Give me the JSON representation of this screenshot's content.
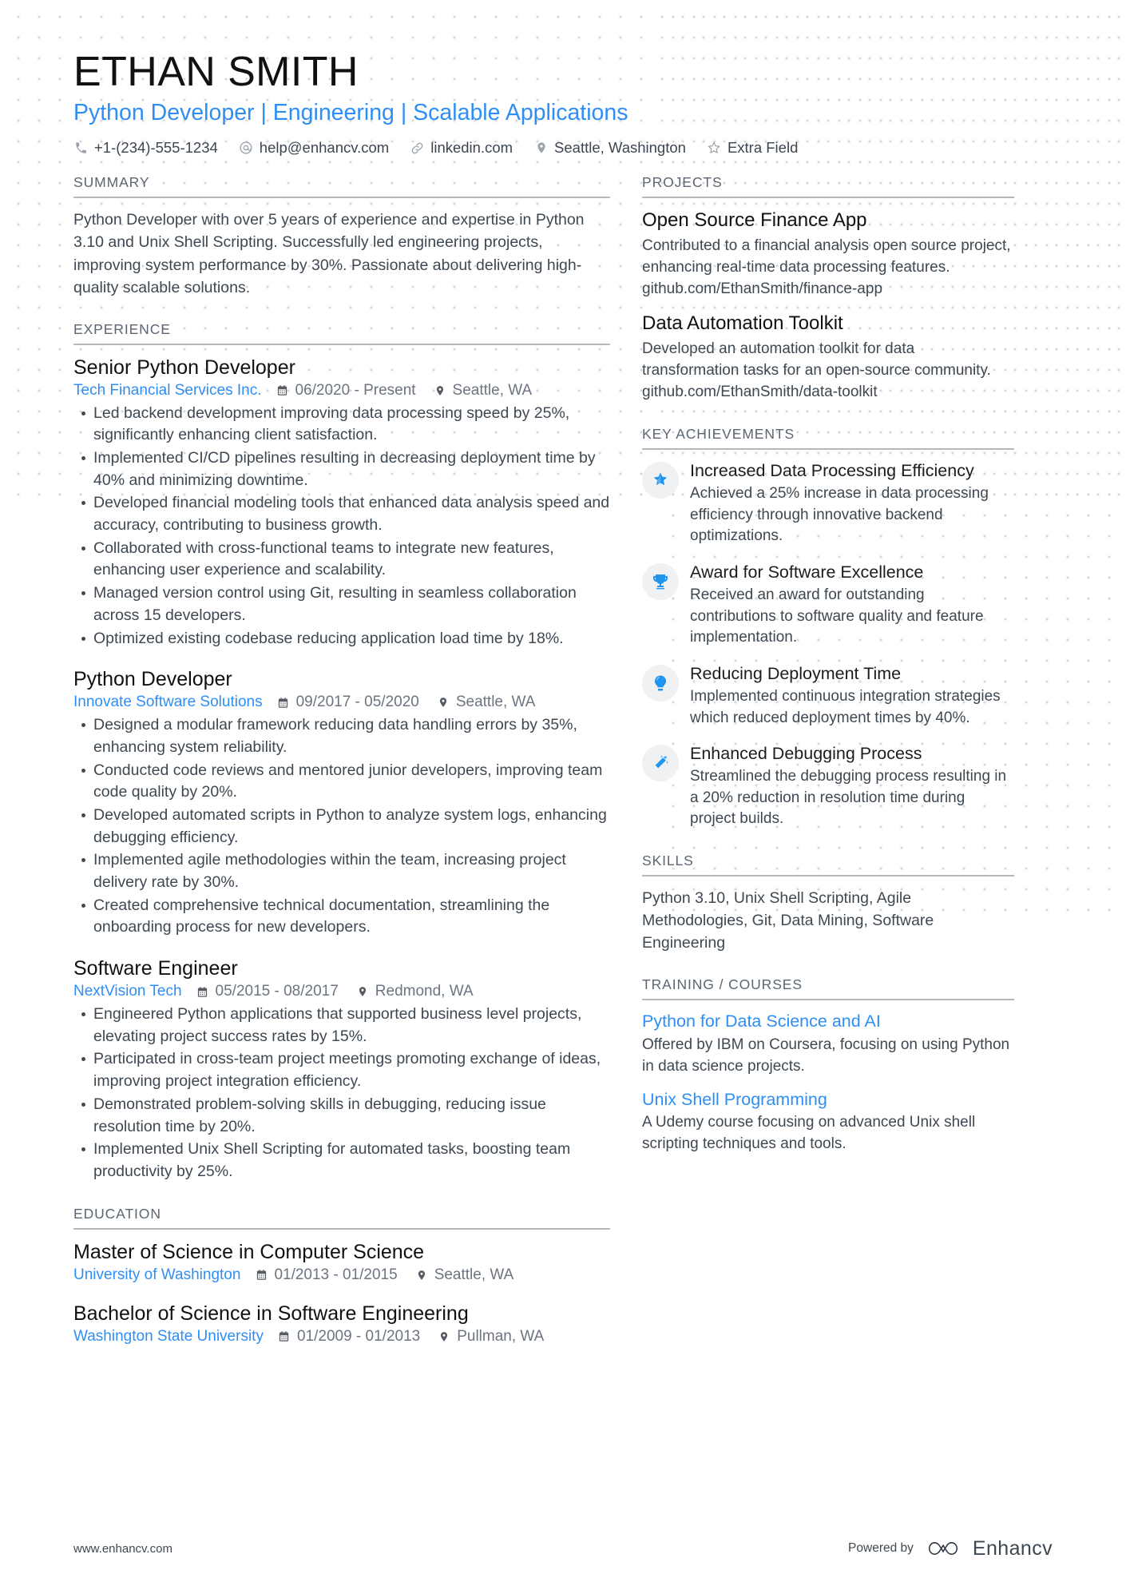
{
  "header": {
    "name": "ETHAN SMITH",
    "headline": "Python Developer | Engineering | Scalable Applications",
    "contacts": [
      {
        "icon": "phone-icon",
        "text": "+1-(234)-555-1234"
      },
      {
        "icon": "email-icon",
        "text": "help@enhancv.com"
      },
      {
        "icon": "link-icon",
        "text": "linkedin.com"
      },
      {
        "icon": "location-pin-icon",
        "text": "Seattle, Washington"
      },
      {
        "icon": "star-outline-icon",
        "text": "Extra Field"
      }
    ]
  },
  "summary": {
    "title": "SUMMARY",
    "text": "Python Developer with over 5 years of experience and expertise in Python 3.10 and Unix Shell Scripting. Successfully led engineering projects, improving system performance by 30%. Passionate about delivering high-quality scalable solutions."
  },
  "experience": {
    "title": "EXPERIENCE",
    "entries": [
      {
        "role": "Senior Python Developer",
        "company": "Tech Financial Services Inc.",
        "dates": "06/2020 - Present",
        "location": "Seattle, WA",
        "bullets": [
          "Led backend development improving data processing speed by 25%, significantly enhancing client satisfaction.",
          "Implemented CI/CD pipelines resulting in decreasing deployment time by 40% and minimizing downtime.",
          "Developed financial modeling tools that enhanced data analysis speed and accuracy, contributing to business growth.",
          "Collaborated with cross-functional teams to integrate new features, enhancing user experience and scalability.",
          "Managed version control using Git, resulting in seamless collaboration across 15 developers.",
          "Optimized existing codebase reducing application load time by 18%."
        ]
      },
      {
        "role": "Python Developer",
        "company": "Innovate Software Solutions",
        "dates": "09/2017 - 05/2020",
        "location": "Seattle, WA",
        "bullets": [
          "Designed a modular framework reducing data handling errors by 35%, enhancing system reliability.",
          "Conducted code reviews and mentored junior developers, improving team code quality by 20%.",
          "Developed automated scripts in Python to analyze system logs, enhancing debugging efficiency.",
          "Implemented agile methodologies within the team, increasing project delivery rate by 30%.",
          "Created comprehensive technical documentation, streamlining the onboarding process for new developers."
        ]
      },
      {
        "role": "Software Engineer",
        "company": "NextVision Tech",
        "dates": "05/2015 - 08/2017",
        "location": "Redmond, WA",
        "bullets": [
          "Engineered Python applications that supported business level projects, elevating project success rates by 15%.",
          "Participated in cross-team project meetings promoting exchange of ideas, improving project integration efficiency.",
          "Demonstrated problem-solving skills in debugging, reducing issue resolution time by 20%.",
          "Implemented Unix Shell Scripting for automated tasks, boosting team productivity by 25%."
        ]
      }
    ]
  },
  "education": {
    "title": "EDUCATION",
    "entries": [
      {
        "degree": "Master of Science in Computer Science",
        "school": "University of Washington",
        "dates": "01/2013 - 01/2015",
        "location": "Seattle, WA"
      },
      {
        "degree": "Bachelor of Science in Software Engineering",
        "school": "Washington State University",
        "dates": "01/2009 - 01/2013",
        "location": "Pullman, WA"
      }
    ]
  },
  "projects": {
    "title": "PROJECTS",
    "entries": [
      {
        "name": "Open Source Finance App",
        "description": "Contributed to a financial analysis open source project, enhancing real-time data processing features. github.com/EthanSmith/finance-app"
      },
      {
        "name": "Data Automation Toolkit",
        "description": "Developed an automation toolkit for data transformation tasks for an open-source community. github.com/EthanSmith/data-toolkit"
      }
    ]
  },
  "key_achievements": {
    "title": "KEY ACHIEVEMENTS",
    "entries": [
      {
        "icon": "star-badge-icon",
        "title": "Increased Data Processing Efficiency",
        "description": "Achieved a 25% increase in data processing efficiency through innovative backend optimizations."
      },
      {
        "icon": "trophy-icon",
        "title": "Award for Software Excellence",
        "description": "Received an award for outstanding contributions to software quality and feature implementation."
      },
      {
        "icon": "lightbulb-icon",
        "title": "Reducing Deployment Time",
        "description": "Implemented continuous integration strategies which reduced deployment times by 40%."
      },
      {
        "icon": "magic-wand-icon",
        "title": "Enhanced Debugging Process",
        "description": "Streamlined the debugging process resulting in a 20% reduction in resolution time during project builds."
      }
    ]
  },
  "skills": {
    "title": "SKILLS",
    "text": "Python 3.10, Unix Shell Scripting, Agile Methodologies, Git, Data Mining, Software Engineering"
  },
  "training": {
    "title": "TRAINING / COURSES",
    "entries": [
      {
        "name": "Python for Data Science and AI",
        "description": "Offered by IBM on Coursera, focusing on using Python in data science projects."
      },
      {
        "name": "Unix Shell Programming",
        "description": "A Udemy course focusing on advanced Unix shell scripting techniques and tools."
      }
    ]
  },
  "footer": {
    "url": "www.enhancv.com",
    "powered_by": "Powered by",
    "brand": "Enhancv"
  },
  "colors": {
    "accent_blue": "#2f8ef4",
    "icon_blue": "#1f95f0",
    "text_dark": "#3e4852",
    "rule_gray": "#b7b7b7"
  }
}
